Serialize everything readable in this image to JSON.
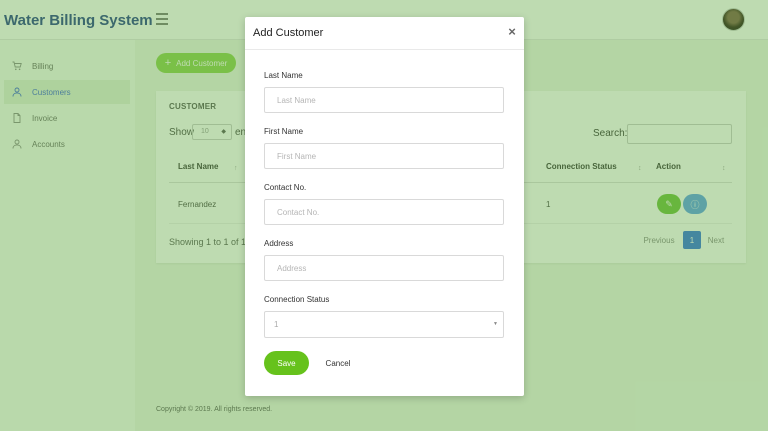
{
  "app": {
    "title": "Water Billing System"
  },
  "sidebar": {
    "items": [
      {
        "label": "Billing",
        "icon": "cart-icon"
      },
      {
        "label": "Customers",
        "icon": "user-icon",
        "active": true
      },
      {
        "label": "Invoice",
        "icon": "document-icon"
      },
      {
        "label": "Accounts",
        "icon": "user-icon"
      }
    ]
  },
  "main": {
    "add_button": "Add Customer",
    "card_title": "CUSTOMER",
    "show_label": "Show",
    "show_value": "10",
    "entries_label": "en",
    "search_label": "Search:",
    "columns": [
      "Last Name",
      "Connection Status",
      "Action"
    ],
    "rows": [
      {
        "last_name": "Fernandez",
        "connection_status": "1"
      }
    ],
    "showing_text": "Showing 1 to 1 of 1",
    "pager": {
      "previous": "Previous",
      "page": "1",
      "next": "Next"
    }
  },
  "footer": {
    "text": "Copyright © 2019. All rights reserved."
  },
  "modal": {
    "title": "Add Customer",
    "close": "×",
    "fields": [
      {
        "label": "Last Name",
        "placeholder": "Last Name"
      },
      {
        "label": "First Name",
        "placeholder": "First Name"
      },
      {
        "label": "Contact No.",
        "placeholder": "Contact No."
      },
      {
        "label": "Address",
        "placeholder": "Address"
      }
    ],
    "connection_status": {
      "label": "Connection Status",
      "value": "1"
    },
    "save": "Save",
    "cancel": "Cancel"
  },
  "colors": {
    "brand": "#1f3a8a",
    "accent_green": "#66c21c",
    "overlay": "#64aa46",
    "link_blue": "#3b5fd9",
    "page_active": "#2f6fe0"
  }
}
